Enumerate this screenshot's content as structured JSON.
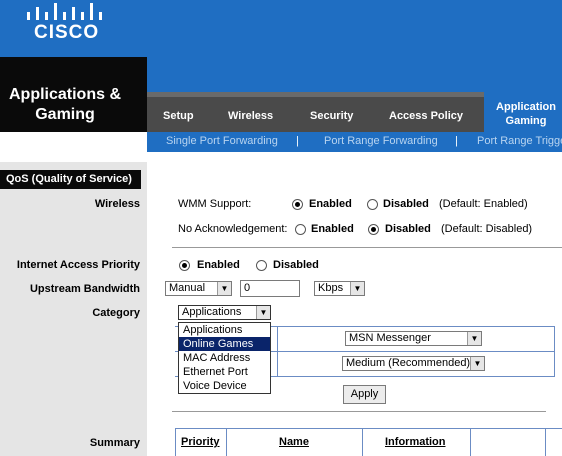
{
  "header": {
    "brand": "cisco",
    "section_title_line1": "Applications &",
    "section_title_line2": "Gaming"
  },
  "nav": {
    "tabs": [
      {
        "label": "Setup"
      },
      {
        "label": "Wireless"
      },
      {
        "label": "Security"
      },
      {
        "label": "Access Policy"
      }
    ],
    "active_tab_line1": "Application",
    "active_tab_line2": "Gaming",
    "subtabs": [
      {
        "label": "Single Port Forwarding"
      },
      {
        "label": "Port Range Forwarding"
      },
      {
        "label": "Port Range Trigge"
      }
    ],
    "separator": "|"
  },
  "sidebar": {
    "section": "QoS (Quality of Service)",
    "labels": {
      "wireless": "Wireless",
      "internet_access_priority": "Internet Access Priority",
      "upstream_bandwidth": "Upstream Bandwidth",
      "category": "Category",
      "summary": "Summary"
    }
  },
  "wireless": {
    "wmm_label": "WMM Support:",
    "wmm_enabled": "Enabled",
    "wmm_disabled": "Disabled",
    "wmm_default": "(Default: Enabled)",
    "noack_label": "No Acknowledgement:",
    "noack_enabled": "Enabled",
    "noack_disabled": "Disabled",
    "noack_default": "(Default: Disabled)"
  },
  "internet_priority": {
    "enabled": "Enabled",
    "disabled": "Disabled"
  },
  "upstream": {
    "mode": "Manual",
    "value": "0",
    "unit": "Kbps"
  },
  "category": {
    "selected": "Applications",
    "options": [
      "Applications",
      "Online Games",
      "MAC Address",
      "Ethernet Port",
      "Voice Device"
    ],
    "highlighted": "Online Games"
  },
  "application_select": "MSN Messenger",
  "priority_select": "Medium (Recommended)",
  "apply_label": "Apply",
  "summary_table": {
    "headers": [
      "Priority",
      "Name",
      "Information"
    ]
  },
  "colors": {
    "brand_blue": "#1f6ec2",
    "nav_dark": "#4a4a4a",
    "highlight": "#0a246a"
  }
}
